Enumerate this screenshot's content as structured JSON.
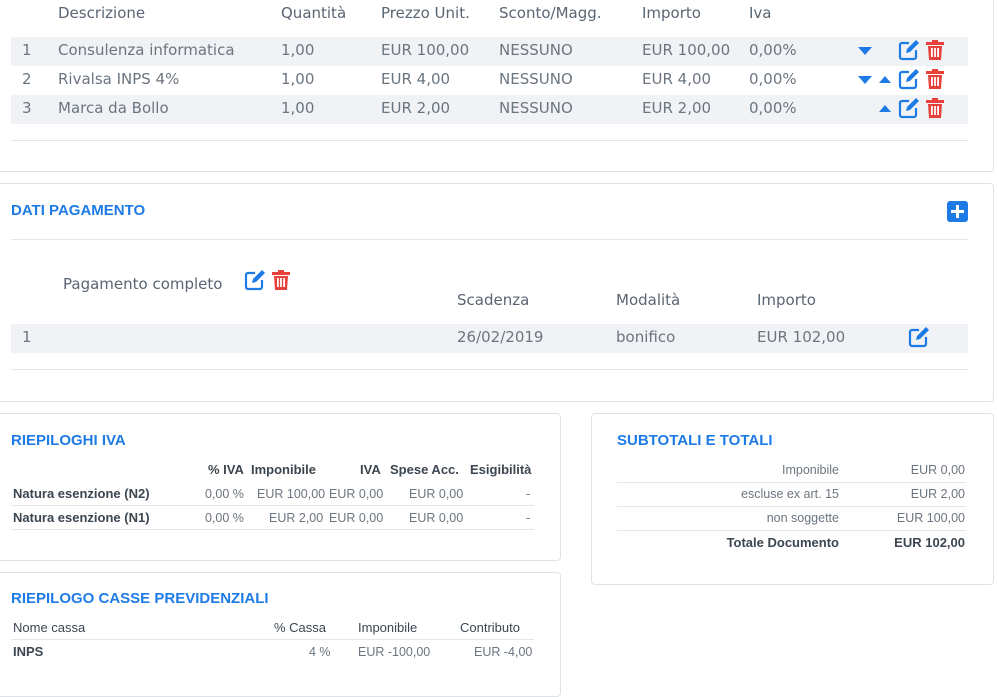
{
  "items_table": {
    "headers": {
      "descrizione": "Descrizione",
      "quantita": "Quantità",
      "prezzo": "Prezzo Unit.",
      "sconto": "Sconto/Magg.",
      "importo": "Importo",
      "iva": "Iva"
    },
    "rows": [
      {
        "n": "1",
        "descrizione": "Consulenza informatica",
        "quantita": "1,00",
        "prezzo": "EUR 100,00",
        "sconto": "NESSUNO",
        "importo": "EUR 100,00",
        "iva": "0,00%"
      },
      {
        "n": "2",
        "descrizione": "Rivalsa INPS 4%",
        "quantita": "1,00",
        "prezzo": "EUR 4,00",
        "sconto": "NESSUNO",
        "importo": "EUR 4,00",
        "iva": "0,00%"
      },
      {
        "n": "3",
        "descrizione": "Marca da Bollo",
        "quantita": "1,00",
        "prezzo": "EUR 2,00",
        "sconto": "NESSUNO",
        "importo": "EUR 2,00",
        "iva": "0,00%"
      }
    ]
  },
  "pagamento": {
    "title": "DATI PAGAMENTO",
    "subtitle": "Pagamento completo",
    "headers": {
      "scadenza": "Scadenza",
      "modalita": "Modalità",
      "importo": "Importo"
    },
    "row": {
      "n": "1",
      "scadenza": "26/02/2019",
      "modalita": "bonifico",
      "importo": "EUR 102,00"
    }
  },
  "riepiloghi_iva": {
    "title": "RIEPILOGHI IVA",
    "headers": {
      "pct": "% IVA",
      "imponibile": "Imponibile",
      "iva": "IVA",
      "spese": "Spese Acc.",
      "esig": "Esigibilità"
    },
    "rows": [
      {
        "label": "Natura esenzione (N2)",
        "pct": "0,00 %",
        "imponibile": "EUR 100,00",
        "iva": "EUR 0,00",
        "spese": "EUR 0,00",
        "esig": "-"
      },
      {
        "label": "Natura esenzione (N1)",
        "pct": "0,00 %",
        "imponibile": "EUR 2,00",
        "iva": "EUR 0,00",
        "spese": "EUR 0,00",
        "esig": "-"
      }
    ]
  },
  "casse": {
    "title": "RIEPILOGO CASSE PREVIDENZIALI",
    "headers": {
      "nome": "Nome cassa",
      "pct": "% Cassa",
      "imponibile": "Imponibile",
      "contributo": "Contributo"
    },
    "row": {
      "nome": "INPS",
      "pct": "4 %",
      "imponibile": "EUR -100,00",
      "contributo": "EUR -4,00"
    }
  },
  "totali": {
    "title": "SUBTOTALI E TOTALI",
    "rows": [
      {
        "label": "Imponibile",
        "value": "EUR 0,00"
      },
      {
        "label": "escluse ex art. 15",
        "value": "EUR 2,00"
      },
      {
        "label": "non soggette",
        "value": "EUR 100,00"
      }
    ],
    "total": {
      "label": "Totale Documento",
      "value": "EUR 102,00"
    }
  },
  "colors": {
    "accent": "#1e7be6",
    "danger": "#e8413b",
    "row_bg": "#f0f2f5"
  },
  "icons": {
    "edit": "edit-icon",
    "delete": "trash-icon",
    "add": "plus-square-icon",
    "move_down": "arrow-down-icon",
    "move_up": "arrow-up-icon"
  }
}
